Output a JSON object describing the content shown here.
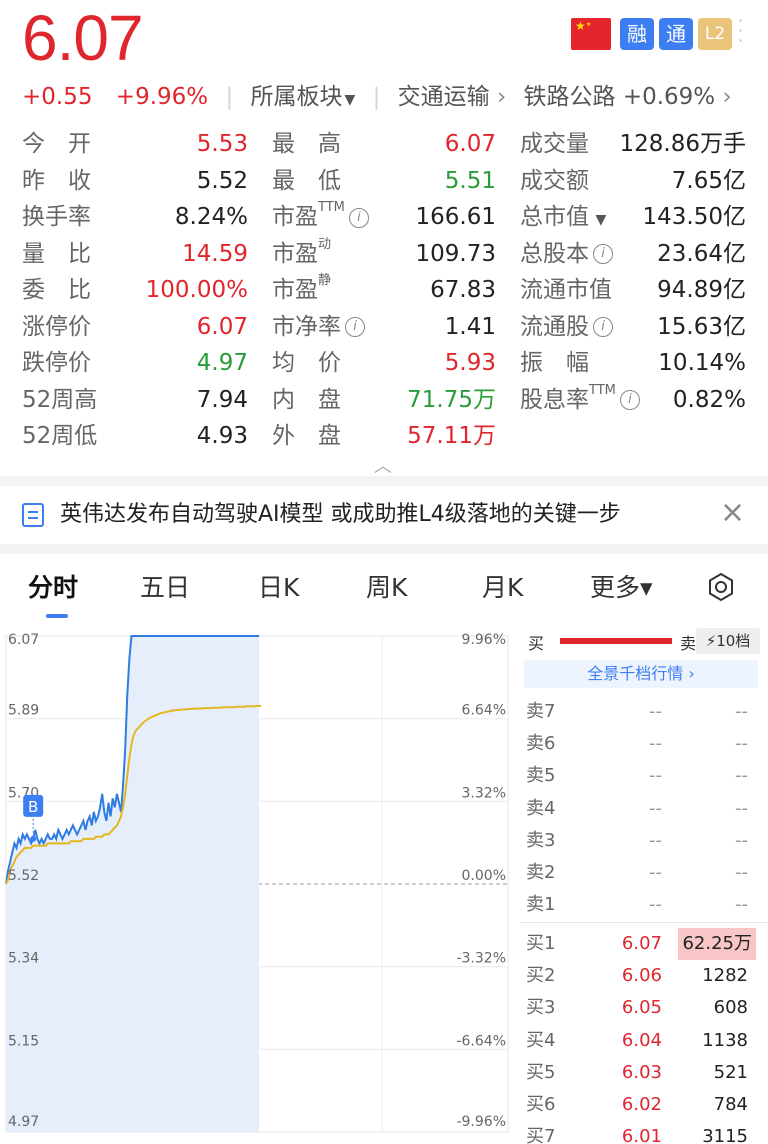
{
  "header": {
    "price": "6.07",
    "change": "+0.55",
    "change_pct": "+9.96%",
    "sector_menu": "所属板块",
    "industry": "交通运输",
    "industry_arrow": "›",
    "sub_industry": "铁路公路",
    "sub_industry_pct": "+0.69%",
    "sub_industry_arrow": "›",
    "badges": {
      "rong": "融",
      "tong": "通",
      "l2": "L2"
    }
  },
  "stats": {
    "rows": [
      [
        {
          "label": "今　开",
          "value": "5.53",
          "color": "red"
        },
        {
          "label": "最　高",
          "value": "6.07",
          "color": "red"
        },
        {
          "label": "成交量",
          "value": "128.86万手",
          "color": "dark"
        }
      ],
      [
        {
          "label": "昨　收",
          "value": "5.52",
          "color": "dark"
        },
        {
          "label": "最　低",
          "value": "5.51",
          "color": "green"
        },
        {
          "label": "成交额",
          "value": "7.65亿",
          "color": "dark"
        }
      ],
      [
        {
          "label": "换手率",
          "value": "8.24%",
          "color": "dark"
        },
        {
          "label": "市盈",
          "sup": "TTM",
          "info": true,
          "value": "166.61",
          "color": "dark"
        },
        {
          "label": "总市值",
          "tri": true,
          "value": "143.50亿",
          "color": "dark"
        }
      ],
      [
        {
          "label": "量　比",
          "value": "14.59",
          "color": "red"
        },
        {
          "label": "市盈",
          "sup": "动",
          "value": "109.73",
          "color": "dark"
        },
        {
          "label": "总股本",
          "info": true,
          "value": "23.64亿",
          "color": "dark"
        }
      ],
      [
        {
          "label": "委　比",
          "value": "100.00%",
          "color": "red"
        },
        {
          "label": "市盈",
          "sup": "静",
          "value": "67.83",
          "color": "dark"
        },
        {
          "label": "流通市值",
          "value": "94.89亿",
          "color": "dark"
        }
      ],
      [
        {
          "label": "涨停价",
          "value": "6.07",
          "color": "red"
        },
        {
          "label": "市净率",
          "info": true,
          "value": "1.41",
          "color": "dark"
        },
        {
          "label": "流通股",
          "info": true,
          "value": "15.63亿",
          "color": "dark"
        }
      ],
      [
        {
          "label": "跌停价",
          "value": "4.97",
          "color": "green"
        },
        {
          "label": "均　价",
          "value": "5.93",
          "color": "red"
        },
        {
          "label": "振　幅",
          "value": "10.14%",
          "color": "dark"
        }
      ],
      [
        {
          "label": "52周高",
          "value": "7.94",
          "color": "dark"
        },
        {
          "label": "内　盘",
          "value": "71.75万",
          "color": "green"
        },
        {
          "label": "股息率",
          "sup": "TTM",
          "info": true,
          "value": "0.82%",
          "color": "dark"
        }
      ],
      [
        {
          "label": "52周低",
          "value": "4.93",
          "color": "dark"
        },
        {
          "label": "外　盘",
          "value": "57.11万",
          "color": "red"
        }
      ]
    ]
  },
  "news": {
    "text": "英伟达发布自动驾驶AI模型 或成助推L4级落地的关键一步",
    "close": "×"
  },
  "tabs": [
    {
      "label": "分时",
      "active": true
    },
    {
      "label": "五日"
    },
    {
      "label": "日K"
    },
    {
      "label": "周K"
    },
    {
      "label": "月K"
    },
    {
      "label": "更多▾"
    }
  ],
  "chart_data": {
    "type": "line",
    "y_left_ticks": [
      "6.07",
      "5.89",
      "5.70",
      "5.52",
      "5.34",
      "5.15",
      "4.97"
    ],
    "y_right_ticks": [
      "9.96%",
      "6.64%",
      "3.32%",
      "0.00%",
      "-3.32%",
      "-6.64%",
      "-9.96%"
    ],
    "ylim": [
      4.97,
      6.07
    ],
    "prev_close": 5.52,
    "marker": "B",
    "series": [
      {
        "values": [
          5.52,
          5.55,
          5.57,
          5.59,
          5.61,
          5.6,
          5.62,
          5.61,
          5.63,
          5.62,
          5.63,
          5.62,
          5.61,
          5.62,
          5.64,
          5.62,
          5.61,
          5.62,
          5.61,
          5.62,
          5.63,
          5.62,
          5.62,
          5.63,
          5.62,
          5.64,
          5.63,
          5.62,
          5.63,
          5.64,
          5.63,
          5.64,
          5.65,
          5.64,
          5.63,
          5.64,
          5.65,
          5.66,
          5.64,
          5.66,
          5.67,
          5.65,
          5.68,
          5.66,
          5.67,
          5.69,
          5.72,
          5.68,
          5.66,
          5.7,
          5.67,
          5.71,
          5.69,
          5.72,
          5.7,
          5.68,
          5.74,
          5.82,
          5.94,
          6.02,
          6.07,
          6.07,
          6.07,
          6.07,
          6.07,
          6.07,
          6.07,
          6.07,
          6.07,
          6.07,
          6.07,
          6.07,
          6.07,
          6.07,
          6.07,
          6.07,
          6.07,
          6.07,
          6.07,
          6.07,
          6.07,
          6.07,
          6.07,
          6.07,
          6.07,
          6.07,
          6.07,
          6.07,
          6.07,
          6.07,
          6.07,
          6.07,
          6.07,
          6.07,
          6.07,
          6.07,
          6.07,
          6.07,
          6.07,
          6.07,
          6.07,
          6.07,
          6.07,
          6.07,
          6.07,
          6.07,
          6.07,
          6.07,
          6.07,
          6.07,
          6.07,
          6.07,
          6.07,
          6.07,
          6.07,
          6.07,
          6.07,
          6.07,
          6.07,
          6.07,
          6.07,
          6.07
        ]
      },
      {
        "values": [
          5.52,
          5.53,
          5.55,
          5.56,
          5.57,
          5.58,
          5.585,
          5.59,
          5.595,
          5.6,
          5.6,
          5.6,
          5.6,
          5.605,
          5.605,
          5.605,
          5.605,
          5.605,
          5.605,
          5.605,
          5.61,
          5.61,
          5.61,
          5.61,
          5.61,
          5.61,
          5.61,
          5.61,
          5.61,
          5.61,
          5.61,
          5.615,
          5.615,
          5.615,
          5.615,
          5.615,
          5.615,
          5.62,
          5.62,
          5.62,
          5.62,
          5.62,
          5.62,
          5.625,
          5.625,
          5.625,
          5.625,
          5.63,
          5.63,
          5.63,
          5.635,
          5.64,
          5.645,
          5.65,
          5.66,
          5.67,
          5.69,
          5.72,
          5.76,
          5.8,
          5.83,
          5.85,
          5.86,
          5.865,
          5.87,
          5.875,
          5.88,
          5.883,
          5.886,
          5.889,
          5.891,
          5.893,
          5.895,
          5.897,
          5.899,
          5.9,
          5.901,
          5.902,
          5.903,
          5.904,
          5.905,
          5.905,
          5.906,
          5.906,
          5.907,
          5.907,
          5.907,
          5.908,
          5.908,
          5.908,
          5.909,
          5.909,
          5.909,
          5.909,
          5.91,
          5.91,
          5.91,
          5.91,
          5.91,
          5.911,
          5.911,
          5.911,
          5.911,
          5.911,
          5.912,
          5.912,
          5.912,
          5.912,
          5.912,
          5.912,
          5.913,
          5.913,
          5.913,
          5.913,
          5.913,
          5.914,
          5.914,
          5.914,
          5.914,
          5.914,
          5.915,
          5.915,
          5.915
        ]
      }
    ],
    "colors": {
      "price": "#2f7de1",
      "avg": "#e5b620",
      "fill": "#e6eefb"
    }
  },
  "book": {
    "buy_label": "买",
    "sell_label": "卖",
    "levels_button": "⚡10档",
    "full_depth": "全景千档行情 ›",
    "asks": [
      {
        "label": "卖7",
        "price": "--",
        "vol": "--"
      },
      {
        "label": "卖6",
        "price": "--",
        "vol": "--"
      },
      {
        "label": "卖5",
        "price": "--",
        "vol": "--"
      },
      {
        "label": "卖4",
        "price": "--",
        "vol": "--"
      },
      {
        "label": "卖3",
        "price": "--",
        "vol": "--"
      },
      {
        "label": "卖2",
        "price": "--",
        "vol": "--"
      },
      {
        "label": "卖1",
        "price": "--",
        "vol": "--"
      }
    ],
    "bids": [
      {
        "label": "买1",
        "price": "6.07",
        "vol": "62.25万",
        "highlight": true
      },
      {
        "label": "买2",
        "price": "6.06",
        "vol": "1282"
      },
      {
        "label": "买3",
        "price": "6.05",
        "vol": "608"
      },
      {
        "label": "买4",
        "price": "6.04",
        "vol": "1138"
      },
      {
        "label": "买5",
        "price": "6.03",
        "vol": "521"
      },
      {
        "label": "买6",
        "price": "6.02",
        "vol": "784"
      },
      {
        "label": "买7",
        "price": "6.01",
        "vol": "3115"
      }
    ]
  },
  "icons": {
    "info": "info-icon",
    "settings": "settings-icon",
    "news": "news-icon",
    "close": "close-icon",
    "flag": "china-flag-icon"
  },
  "colors": {
    "up": "#e0262d",
    "down": "#2a9d3a",
    "accent": "#3d7ef2"
  }
}
